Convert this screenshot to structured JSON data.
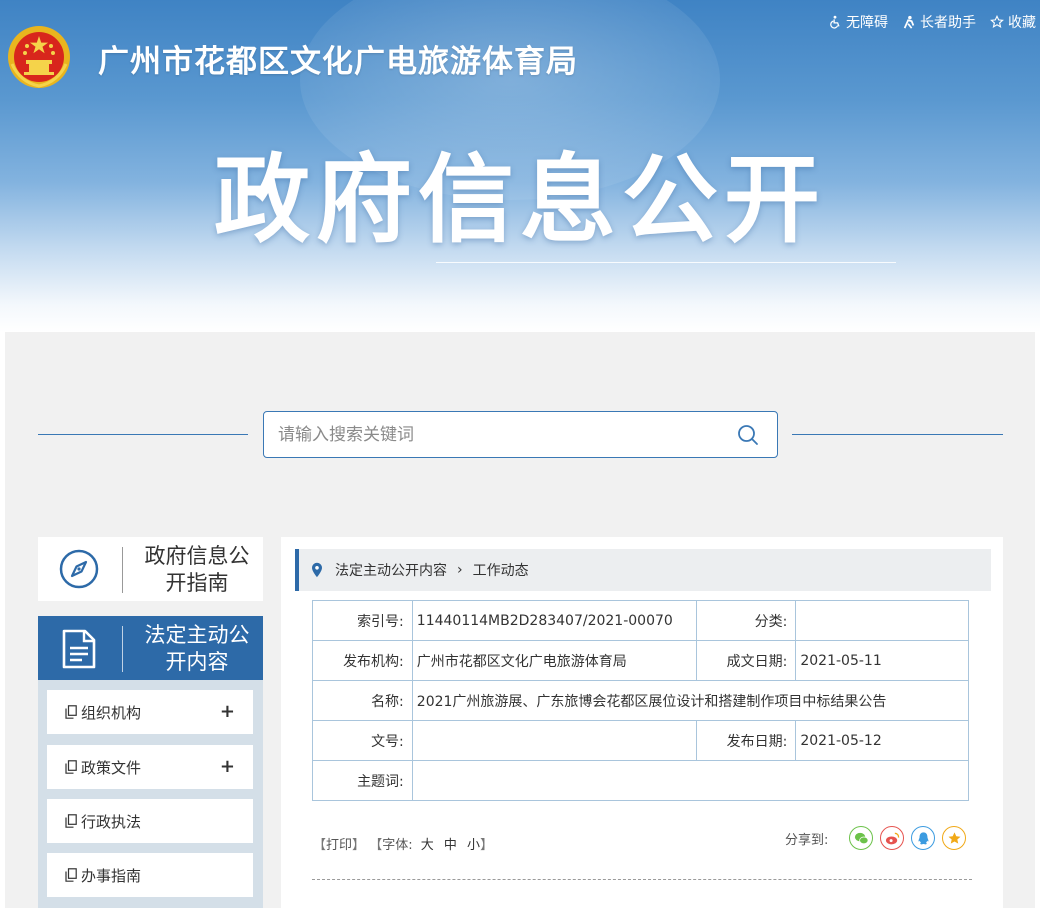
{
  "header": {
    "site_title": "广州市花都区文化广电旅游体育局",
    "banner_title": "政府信息公开",
    "top_links": [
      {
        "label": "无障碍",
        "icon": "accessibility-icon"
      },
      {
        "label": "长者助手",
        "icon": "elder-assistant-icon"
      },
      {
        "label": "收藏",
        "icon": "star-icon"
      }
    ]
  },
  "search": {
    "placeholder": "请输入搜索关键词"
  },
  "sidebar": {
    "guide_label": "政府信息公开指南",
    "active_label": "法定主动公开内容",
    "items": [
      {
        "label": "组织机构",
        "expand": "+"
      },
      {
        "label": "政策文件",
        "expand": "+"
      },
      {
        "label": "行政执法"
      },
      {
        "label": "办事指南"
      }
    ]
  },
  "breadcrumb": {
    "level1": "法定主动公开内容",
    "separator": "›",
    "level2": "工作动态"
  },
  "info": {
    "index_key": "索引号:",
    "index_value": "11440114MB2D283407/2021-00070",
    "category_key": "分类:",
    "category_value": "",
    "publisher_key": "发布机构:",
    "publisher_value": "广州市花都区文化广电旅游体育局",
    "created_key": "成文日期:",
    "created_value": "2021-05-11",
    "name_key": "名称:",
    "name_value": "2021广州旅游展、广东旅博会花都区展位设计和搭建制作项目中标结果公告",
    "docno_key": "文号:",
    "docno_value": "",
    "published_key": "发布日期:",
    "published_value": "2021-05-12",
    "subject_key": "主题词:",
    "subject_value": ""
  },
  "tools": {
    "print": "打印",
    "font_label": "字体:",
    "font_large": "大",
    "font_medium": "中",
    "font_small": "小",
    "share_label": "分享到:"
  },
  "colors": {
    "primary": "#2d6aa8",
    "wechat": "#6cc24a",
    "weibo": "#e6534f",
    "qq": "#3b9be0",
    "qzone": "#f1a917"
  }
}
